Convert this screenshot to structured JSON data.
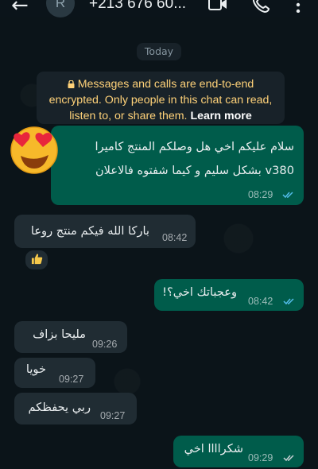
{
  "header": {
    "avatar_letter": "R",
    "contact": "+213 676 60..."
  },
  "date_divider": "Today",
  "encryption_notice": {
    "line1": "Messages and calls are end-to-end",
    "line2": "encrypted. Only people in this chat can read,",
    "line3": "listen to, or share them.",
    "learn_more": "Learn more"
  },
  "messages": [
    {
      "dir": "out",
      "lines": [
        "سلام عليكم اخي هل وصلكم المنتج كاميرا",
        "v380 بشكل سليم و كيما شفتوه فالاعلان"
      ],
      "time": "08:29",
      "read": true
    },
    {
      "dir": "in",
      "lines": [
        "باركا الله فيكم منتج روعا"
      ],
      "time": "08:42",
      "reaction": "thumbs-up"
    },
    {
      "dir": "out",
      "lines": [
        "وعجباتك اخي؟!"
      ],
      "time": "08:42",
      "read": true
    },
    {
      "dir": "in",
      "lines": [
        "مليحا بزاف"
      ],
      "time": "09:26"
    },
    {
      "dir": "in",
      "lines": [
        "خويا"
      ],
      "time": "09:27"
    },
    {
      "dir": "in",
      "lines": [
        "ربي يحفظكم"
      ],
      "time": "09:27"
    },
    {
      "dir": "out",
      "lines": [
        "شكراااا اخي"
      ],
      "time": "09:29",
      "read": true
    }
  ],
  "colors": {
    "background": "#0b1419",
    "outgoing_bubble": "#005c4b",
    "incoming_bubble": "#202c33",
    "read_ticks": "#53bdeb",
    "encryption_text": "#ffd279"
  },
  "icons": [
    "back-arrow-icon",
    "video-call-icon",
    "voice-call-icon",
    "more-menu-icon",
    "lock-icon",
    "double-check-icon",
    "heart-eyes-emoji",
    "thumbs-up-icon"
  ]
}
